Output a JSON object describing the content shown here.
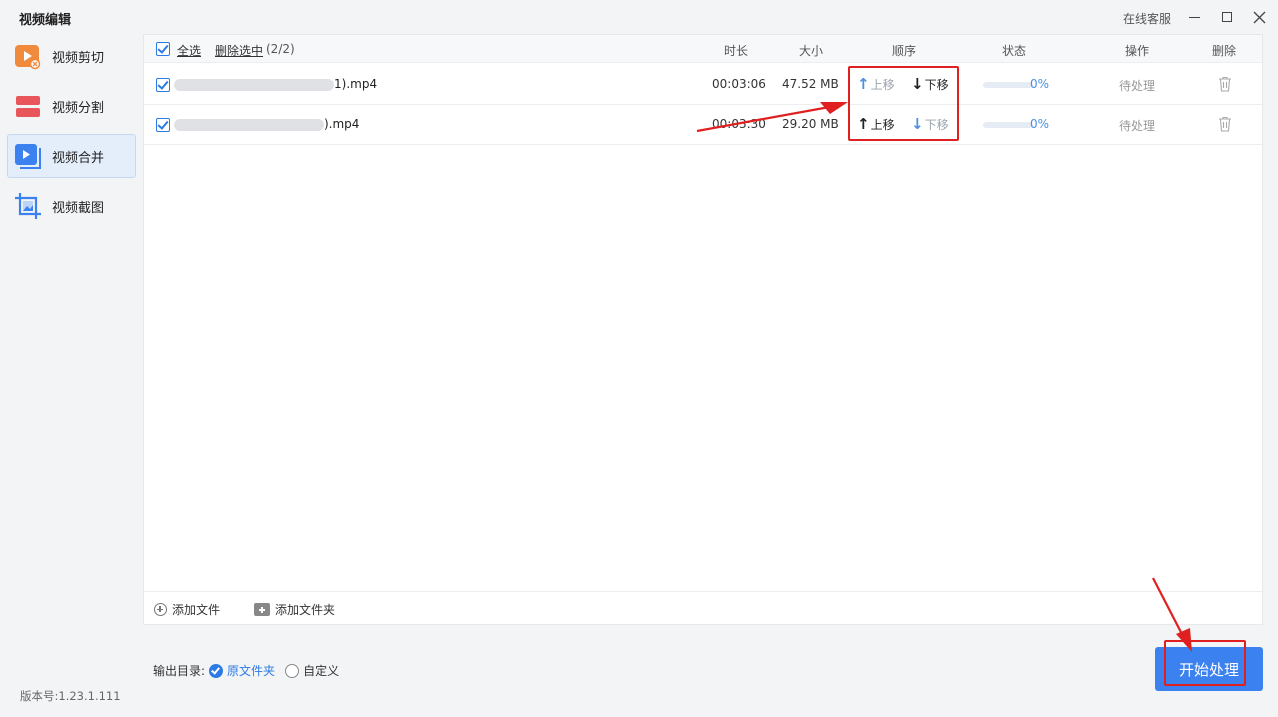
{
  "window": {
    "title": "视频编辑",
    "support_link": "在线客服"
  },
  "sidebar": {
    "items": [
      {
        "label": "视频剪切",
        "icon": "video-cut-icon",
        "active": false
      },
      {
        "label": "视频分割",
        "icon": "video-split-icon",
        "active": false
      },
      {
        "label": "视频合并",
        "icon": "video-merge-icon",
        "active": true
      },
      {
        "label": "视频截图",
        "icon": "video-screenshot-icon",
        "active": false
      }
    ],
    "version": "版本号:1.23.1.111"
  },
  "table": {
    "select_all": "全选",
    "delete_selected": "删除选中",
    "selected_count": "(2/2)",
    "columns": {
      "duration": "时长",
      "size": "大小",
      "order": "顺序",
      "status": "状态",
      "action": "操作",
      "delete": "删除"
    },
    "rows": [
      {
        "filename_visible": "1).mp4",
        "duration": "00:03:06",
        "size": "47.52 MB",
        "move_up": "上移",
        "move_down": "下移",
        "move_up_enabled": false,
        "move_down_enabled": true,
        "progress": "0%",
        "status": "待处理"
      },
      {
        "filename_visible": ").mp4",
        "duration": "00:03:30",
        "size": "29.20 MB",
        "move_up": "上移",
        "move_down": "下移",
        "move_up_enabled": true,
        "move_down_enabled": false,
        "progress": "0%",
        "status": "待处理"
      }
    ],
    "add_file": "添加文件",
    "add_folder": "添加文件夹"
  },
  "output": {
    "label": "输出目录:",
    "option_original": "原文件夹",
    "option_custom": "自定义",
    "selected": "原文件夹"
  },
  "start_button": "开始处理",
  "colors": {
    "accent": "#2c7be5",
    "start_button": "#3b82f0",
    "annotation": "#e02020"
  }
}
